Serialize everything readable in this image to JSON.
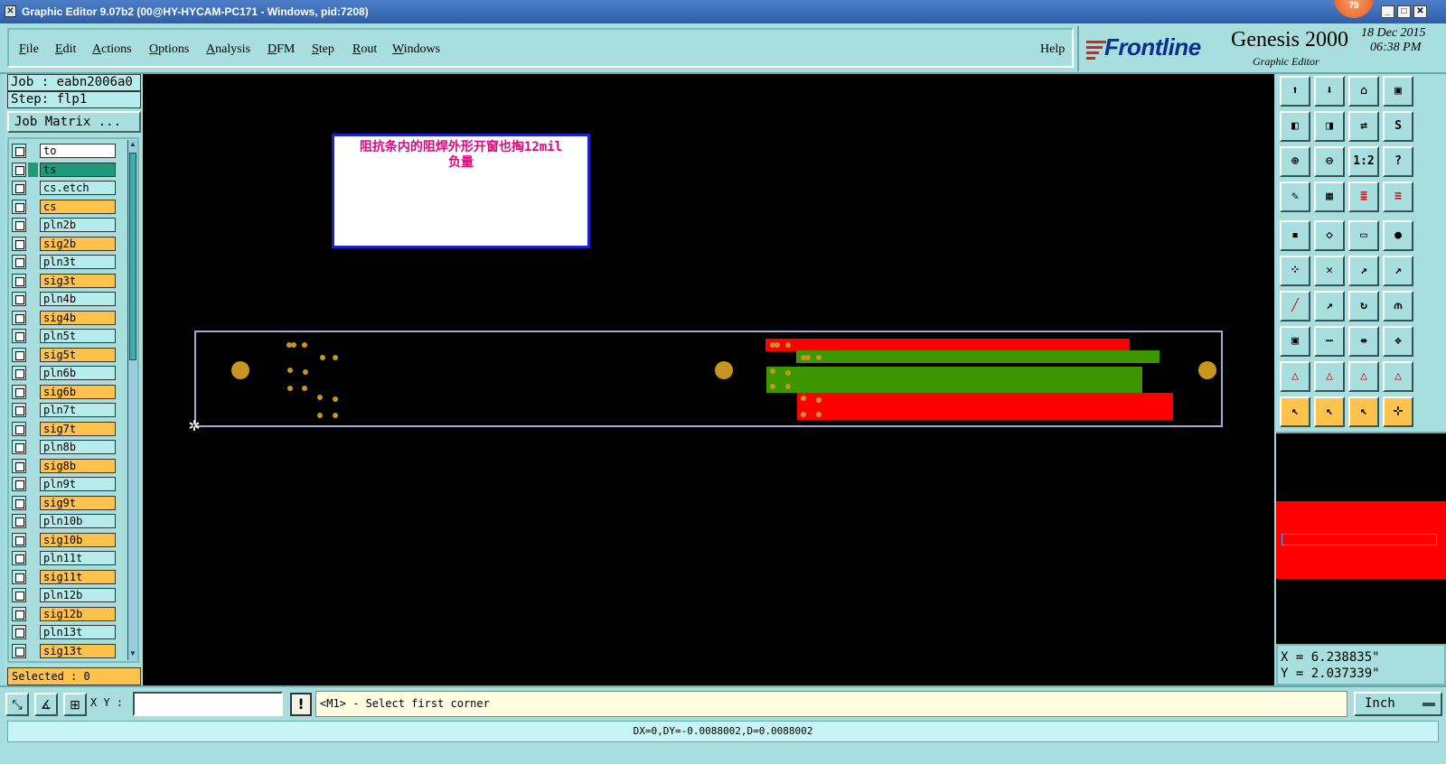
{
  "window": {
    "title": "Graphic Editor 9.07b2 (00@HY-HYCAM-PC171 - Windows, pid:7208)",
    "notification_count": "79"
  },
  "menubar": {
    "items": [
      "File",
      "Edit",
      "Actions",
      "Options",
      "Analysis",
      "DFM",
      "Step",
      "Rout",
      "Windows"
    ],
    "help": "Help"
  },
  "brand": {
    "logo": "Frontline",
    "product": "Genesis 2000",
    "subtitle": "Graphic Editor",
    "date": "18 Dec 2015",
    "time": "06:38 PM"
  },
  "left": {
    "job": "Job : eabn2006a0",
    "step": "Step: flp1",
    "job_matrix": "Job Matrix ...",
    "selected": "Selected : 0",
    "layers": [
      {
        "name": "to",
        "bg": "#ffffff",
        "swatch": ""
      },
      {
        "name": "ts",
        "bg": "#1f9a78",
        "swatch": "#1f9a78"
      },
      {
        "name": "cs.etch",
        "bg": "#b6ecec",
        "swatch": ""
      },
      {
        "name": "cs",
        "bg": "#ffc24c",
        "swatch": ""
      },
      {
        "name": "pln2b",
        "bg": "#b6ecec",
        "swatch": ""
      },
      {
        "name": "sig2b",
        "bg": "#ffc24c",
        "swatch": ""
      },
      {
        "name": "pln3t",
        "bg": "#b6ecec",
        "swatch": ""
      },
      {
        "name": "sig3t",
        "bg": "#ffc24c",
        "swatch": ""
      },
      {
        "name": "pln4b",
        "bg": "#b6ecec",
        "swatch": ""
      },
      {
        "name": "sig4b",
        "bg": "#ffc24c",
        "swatch": ""
      },
      {
        "name": "pln5t",
        "bg": "#b6ecec",
        "swatch": ""
      },
      {
        "name": "sig5t",
        "bg": "#ffc24c",
        "swatch": ""
      },
      {
        "name": "pln6b",
        "bg": "#b6ecec",
        "swatch": ""
      },
      {
        "name": "sig6b",
        "bg": "#ffc24c",
        "swatch": ""
      },
      {
        "name": "pln7t",
        "bg": "#b6ecec",
        "swatch": ""
      },
      {
        "name": "sig7t",
        "bg": "#ffc24c",
        "swatch": ""
      },
      {
        "name": "pln8b",
        "bg": "#b6ecec",
        "swatch": ""
      },
      {
        "name": "sig8b",
        "bg": "#ffc24c",
        "swatch": ""
      },
      {
        "name": "pln9t",
        "bg": "#b6ecec",
        "swatch": ""
      },
      {
        "name": "sig9t",
        "bg": "#ffc24c",
        "swatch": ""
      },
      {
        "name": "pln10b",
        "bg": "#b6ecec",
        "swatch": ""
      },
      {
        "name": "sig10b",
        "bg": "#ffc24c",
        "swatch": ""
      },
      {
        "name": "pln11t",
        "bg": "#b6ecec",
        "swatch": ""
      },
      {
        "name": "sig11t",
        "bg": "#ffc24c",
        "swatch": ""
      },
      {
        "name": "pln12b",
        "bg": "#b6ecec",
        "swatch": ""
      },
      {
        "name": "sig12b",
        "bg": "#ffc24c",
        "swatch": ""
      },
      {
        "name": "pln13t",
        "bg": "#b6ecec",
        "swatch": ""
      },
      {
        "name": "sig13t",
        "bg": "#ffc24c",
        "swatch": ""
      }
    ]
  },
  "canvas": {
    "note_line1": "阻抗条内的阻焊外形开窗也掏12mil",
    "note_line2": "负量",
    "colors": {
      "red": "#ff0000",
      "green": "#3c9600",
      "pad": "#c8961e",
      "outline": "#a8a8d6"
    }
  },
  "right": {
    "tools": [
      "copy-icon",
      "paste-icon",
      "home-icon",
      "window-icon",
      "move-left-icon",
      "move-right-icon",
      "swap-icon",
      "snap-icon",
      "zoom-in-icon",
      "zoom-out-icon",
      "ratio-icon",
      "help-icon",
      "measure-icon",
      "grid-icon",
      "layers-icon",
      "layers2-icon",
      "pad-icon",
      "polygon-icon",
      "ruler-icon",
      "dot-icon",
      "net-icon",
      "cross-icon",
      "node-icon",
      "node2-icon",
      "line-icon",
      "arrow-line-icon",
      "rotate-icon",
      "mirror-icon",
      "pad-edit-icon",
      "minus-icon",
      "resize-icon",
      "group-icon",
      "triangle-icon",
      "triangle2-icon",
      "triangle3-icon",
      "triangle4-icon",
      "select-icon",
      "select-box-icon",
      "select-hex-icon",
      "select-net-icon"
    ],
    "ratio_label": "1:2",
    "help_label": "?",
    "coord_x": "X = 6.238835\"",
    "coord_y": "Y = 2.037339\""
  },
  "bottom": {
    "xy_label": "X Y :",
    "xy_value": "",
    "prompt": "<M1> - Select first corner",
    "units": "Inch",
    "status": "DX=0,DY=-0.0088002,D=0.0088002"
  }
}
